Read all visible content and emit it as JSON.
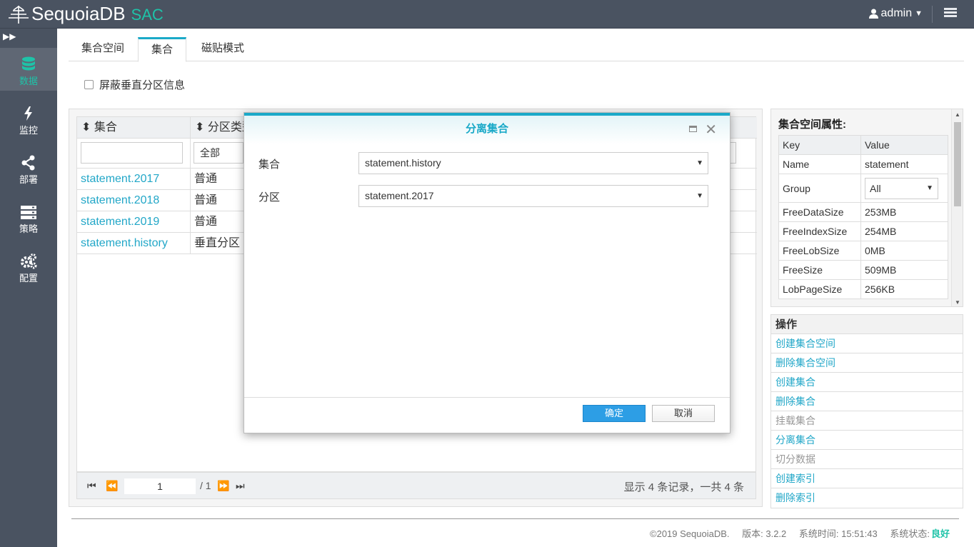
{
  "app": {
    "name": "SequoiaDB",
    "product": "SAC"
  },
  "user": {
    "name": "admin"
  },
  "sidebar": {
    "items": [
      {
        "label": "数据",
        "icon": "database-icon",
        "active": true
      },
      {
        "label": "监控",
        "icon": "lightning-icon",
        "active": false
      },
      {
        "label": "部署",
        "icon": "share-icon",
        "active": false
      },
      {
        "label": "策略",
        "icon": "server-icon",
        "active": false
      },
      {
        "label": "配置",
        "icon": "gears-icon",
        "active": false
      }
    ]
  },
  "tabs": [
    {
      "label": "集合空间",
      "active": false
    },
    {
      "label": "集合",
      "active": true
    },
    {
      "label": "磁贴模式",
      "active": false
    }
  ],
  "hide_vertical_label": "屏蔽垂直分区信息",
  "grid": {
    "columns": [
      "集合",
      "分区类型"
    ],
    "filter_all": "全部",
    "rows": [
      {
        "name": "statement.2017",
        "type": "普通"
      },
      {
        "name": "statement.2018",
        "type": "普通"
      },
      {
        "name": "statement.2019",
        "type": "普通"
      },
      {
        "name": "statement.history",
        "type": "垂直分区"
      }
    ],
    "pager": {
      "page": "1",
      "total": "/ 1",
      "info": "显示 4 条记录，一共 4 条"
    }
  },
  "props": {
    "title": "集合空间属性:",
    "headers": [
      "Key",
      "Value"
    ],
    "rows": [
      {
        "key": "Name",
        "value": "statement"
      },
      {
        "key": "Group",
        "value": "All"
      },
      {
        "key": "FreeDataSize",
        "value": "253MB"
      },
      {
        "key": "FreeIndexSize",
        "value": "254MB"
      },
      {
        "key": "FreeLobSize",
        "value": "0MB"
      },
      {
        "key": "FreeSize",
        "value": "509MB"
      },
      {
        "key": "LobPageSize",
        "value": "256KB"
      }
    ]
  },
  "ops": {
    "title": "操作",
    "items": [
      {
        "label": "创建集合空间",
        "enabled": true
      },
      {
        "label": "删除集合空间",
        "enabled": true
      },
      {
        "label": "创建集合",
        "enabled": true
      },
      {
        "label": "删除集合",
        "enabled": true
      },
      {
        "label": "挂载集合",
        "enabled": false
      },
      {
        "label": "分离集合",
        "enabled": true
      },
      {
        "label": "切分数据",
        "enabled": false
      },
      {
        "label": "创建索引",
        "enabled": true
      },
      {
        "label": "删除索引",
        "enabled": true
      }
    ]
  },
  "modal": {
    "title": "分离集合",
    "fields": [
      {
        "label": "集合",
        "value": "statement.history"
      },
      {
        "label": "分区",
        "value": "statement.2017"
      }
    ],
    "ok": "确定",
    "cancel": "取消"
  },
  "footer": {
    "copyright": "©2019 SequoiaDB.",
    "version": "版本: 3.2.2",
    "time": "系统时间: 15:51:43",
    "status_label": "系统状态:",
    "status_value": "良好"
  },
  "colors": {
    "accent": "#1ec3a8",
    "link": "#22a7c8",
    "chrome": "#4a5361",
    "primary_button": "#2d9ee5"
  }
}
